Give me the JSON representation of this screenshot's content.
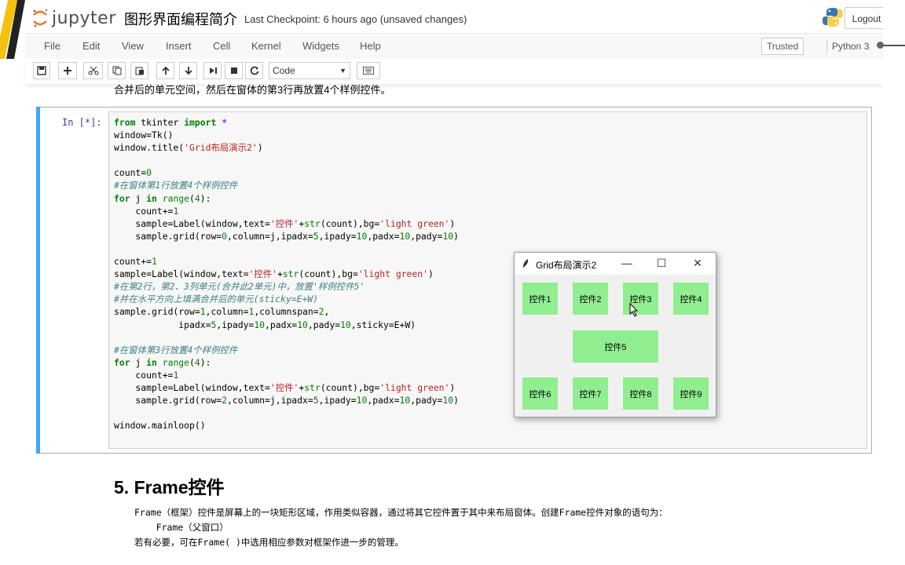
{
  "header": {
    "logo_text": "jupyter",
    "notebook_title": "图形界面编程简介",
    "checkpoint": "Last Checkpoint: 6 hours ago (unsaved changes)",
    "logout_label": "Logout"
  },
  "menubar": {
    "items": [
      "File",
      "Edit",
      "View",
      "Insert",
      "Cell",
      "Kernel",
      "Widgets",
      "Help"
    ],
    "trusted_label": "Trusted",
    "kernel_label": "Python 3"
  },
  "toolbar": {
    "cell_type": "Code",
    "buttons": [
      "save-icon",
      "plus-icon",
      "cut-icon",
      "copy-icon",
      "paste-icon",
      "arrow-up-icon",
      "arrow-down-icon",
      "run-icon",
      "stop-icon",
      "restart-icon",
      "keyboard-icon"
    ]
  },
  "content": {
    "previous_text": "合并后的单元空间，然后在窗体的第3行再放置4个样例控件。",
    "cell_prompt": "In  [*]:",
    "code_lines": [
      "from tkinter import *",
      "window=Tk()",
      "window.title('Grid布局演示2')",
      "",
      "count=0",
      "#在窗体第1行放置4个样例控件",
      "for j in range(4):",
      "    count+=1",
      "    sample=Label(window,text='控件'+str(count),bg='light green')",
      "    sample.grid(row=0,column=j,ipadx=5,ipady=10,padx=10,pady=10)",
      "",
      "count+=1",
      "sample=Label(window,text='控件'+str(count),bg='light green')",
      "#在第2行，第2、3列单元(合并此2单元)中，放置'样例控件5'",
      "#并在水平方向上填满合并后的单元(sticky=E+W)",
      "sample.grid(row=1,column=1,columnspan=2,",
      "            ipadx=5,ipady=10,padx=10,pady=10,sticky=E+W)",
      "",
      "#在窗体第3行放置4个样例控件",
      "for j in range(4):",
      "    count+=1",
      "    sample=Label(window,text='控件'+str(count),bg='light green')",
      "    sample.grid(row=2,column=j,ipadx=5,ipady=10,padx=10,pady=10)",
      "",
      "window.mainloop()"
    ],
    "section_heading": "5. Frame控件",
    "paragraph_1": "Frame（框架）控件是屏幕上的一块矩形区域，作用类似容器，通过将其它控件置于其中来布局窗体。创建Frame控件对象的语句为：",
    "paragraph_2": "    Frame（父窗口）",
    "paragraph_3": "若有必要，可在Frame( )中选用相应参数对框架作进一步的管理。"
  },
  "tk_window": {
    "title": "Grid布局演示2",
    "minimize": "—",
    "maximize": "☐",
    "close": "✕",
    "label_color": "#90ee90",
    "labels": [
      "控件1",
      "控件2",
      "控件3",
      "控件4",
      "控件5",
      "控件6",
      "控件7",
      "控件8",
      "控件9"
    ]
  },
  "colors": {
    "cell_selected_bar": "#42a5f5",
    "prompt": "#303f9f",
    "keyword": "#008000",
    "string": "#ba2121",
    "comment": "#408080"
  }
}
